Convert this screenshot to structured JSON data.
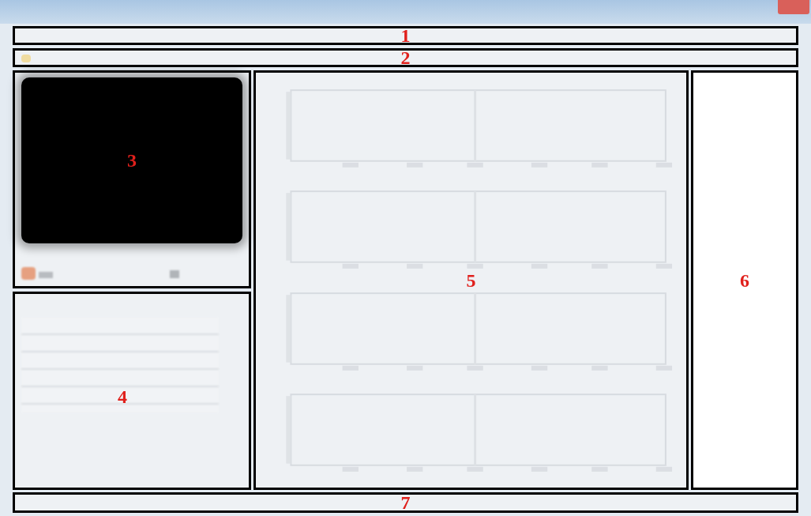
{
  "regions": [
    {
      "label": "1",
      "kind": "menu_bar"
    },
    {
      "label": "2",
      "kind": "toolbar"
    },
    {
      "label": "3",
      "kind": "video"
    },
    {
      "label": "4",
      "kind": "table"
    },
    {
      "label": "5",
      "kind": "charts"
    },
    {
      "label": "6",
      "kind": "list"
    },
    {
      "label": "7",
      "kind": "status_bar"
    }
  ]
}
